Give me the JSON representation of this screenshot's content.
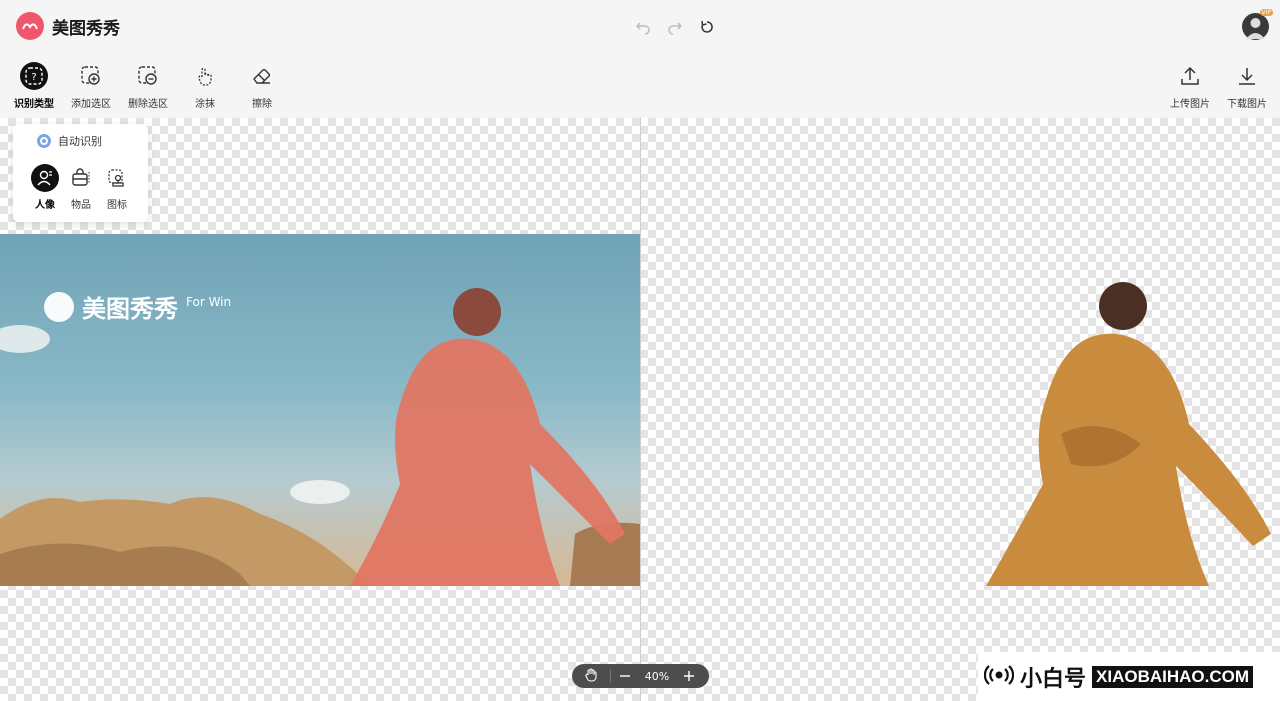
{
  "app": {
    "title": "美图秀秀"
  },
  "history": {
    "undo": "undo-icon",
    "redo": "redo-icon",
    "reset": "reset-icon"
  },
  "user": {
    "vip_badge": "VIP"
  },
  "toolbar": {
    "left": [
      {
        "label": "识别类型",
        "icon": "question-icon",
        "active": true
      },
      {
        "label": "添加选区",
        "icon": "add-selection-icon"
      },
      {
        "label": "删除选区",
        "icon": "remove-selection-icon"
      },
      {
        "label": "涂抹",
        "icon": "smear-icon"
      },
      {
        "label": "擦除",
        "icon": "eraser-icon"
      }
    ],
    "right": [
      {
        "label": "上传图片",
        "icon": "upload-icon"
      },
      {
        "label": "下载图片",
        "icon": "download-icon"
      }
    ]
  },
  "recognition_popup": {
    "auto_label": "自动识别",
    "types": [
      {
        "label": "人像",
        "icon": "portrait-icon",
        "selected": true
      },
      {
        "label": "物品",
        "icon": "object-icon"
      },
      {
        "label": "图标",
        "icon": "stamp-icon"
      }
    ]
  },
  "canvas": {
    "promo_title": "美图秀秀",
    "promo_sub": "For Win"
  },
  "zoom": {
    "value": "40%"
  },
  "watermark": {
    "cn": "小白号",
    "en": "XIAOBAIHAO.COM"
  },
  "colors": {
    "brand": "#f0566b",
    "radio": "#7da4e6",
    "zoom_bg": "#4d4d4d"
  }
}
